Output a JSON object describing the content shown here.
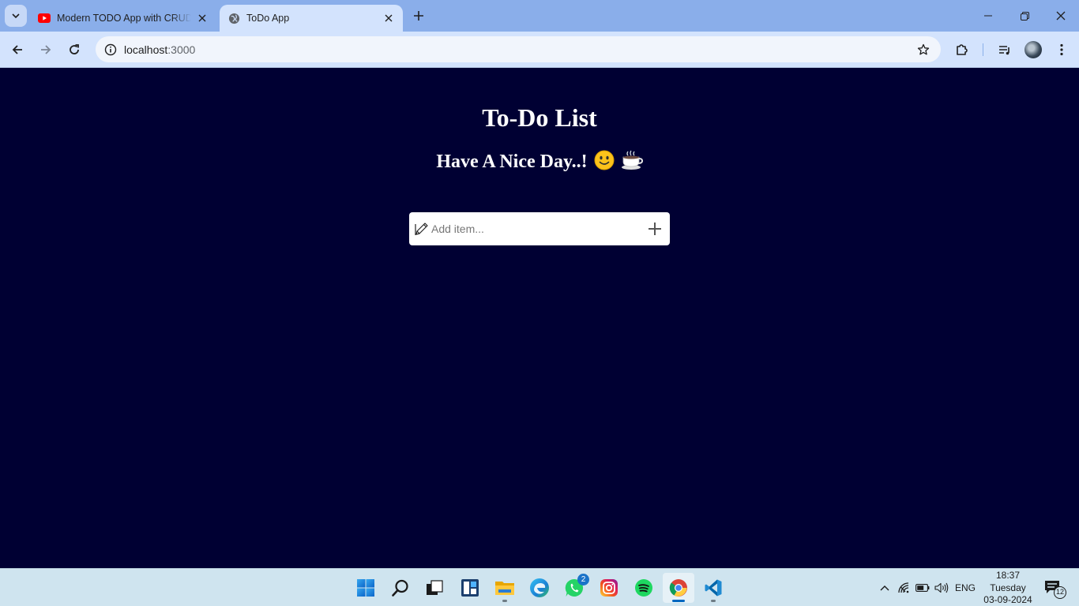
{
  "browser": {
    "tabs": [
      {
        "title": "Modern TODO App with CRUD",
        "favicon": "youtube-icon",
        "active": false
      },
      {
        "title": "ToDo App",
        "favicon": "globe-icon",
        "active": true
      }
    ],
    "address": {
      "host": "localhost",
      "port": ":3000"
    },
    "colors": {
      "tabstrip": "#8aaeea",
      "toolbar": "#d3e3fd",
      "omnibox": "#f1f5fc"
    }
  },
  "app": {
    "title": "To-Do List",
    "greeting": "Have A Nice Day..!",
    "greeting_emojis": [
      "🙂",
      "☕"
    ],
    "input_placeholder": "Add item...",
    "colors": {
      "background": "#000033",
      "text": "#ffffff",
      "input_bg": "#ffffff"
    }
  },
  "taskbar": {
    "apps": [
      {
        "name": "start",
        "icon": "windows-start-icon"
      },
      {
        "name": "search",
        "icon": "search-icon"
      },
      {
        "name": "task-view",
        "icon": "task-view-icon"
      },
      {
        "name": "widgets",
        "icon": "widgets-icon"
      },
      {
        "name": "file-explorer",
        "icon": "folder-icon"
      },
      {
        "name": "edge",
        "icon": "edge-icon"
      },
      {
        "name": "whatsapp",
        "icon": "whatsapp-icon",
        "badge": "2"
      },
      {
        "name": "instagram",
        "icon": "instagram-icon"
      },
      {
        "name": "spotify",
        "icon": "spotify-icon"
      },
      {
        "name": "chrome",
        "icon": "chrome-icon",
        "active": true
      },
      {
        "name": "vscode",
        "icon": "vscode-icon"
      }
    ],
    "tray": {
      "language": "ENG",
      "time": "18:37",
      "day": "Tuesday",
      "date": "03-09-2024",
      "notification_count": "12"
    }
  }
}
